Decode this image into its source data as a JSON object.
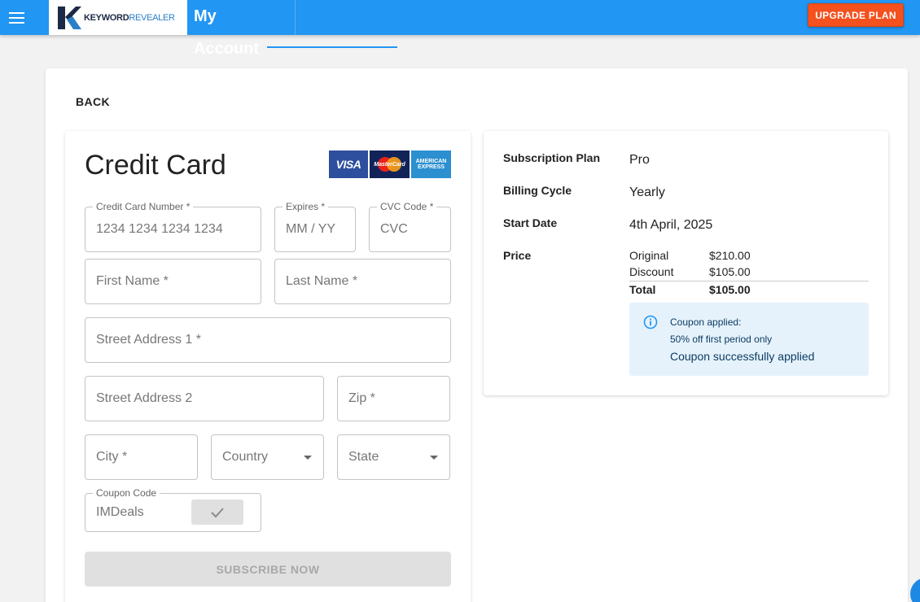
{
  "header": {
    "logo_text_bold": "KEYWORD",
    "logo_text_light": "REVEALER",
    "title": "My Account",
    "upgrade_label": "UPGRADE PLAN",
    "icons": [
      "menu-icon"
    ],
    "colors": {
      "primary": "#2196f3",
      "upgrade": "#f4511e"
    }
  },
  "back_label": "BACK",
  "form": {
    "title": "Credit Card",
    "card_logos": {
      "visa": "VISA",
      "mastercard": "MasterCard",
      "amex_line1": "AMERICAN",
      "amex_line2": "EXPRESS"
    },
    "card_number": {
      "label": "Credit Card Number *",
      "placeholder": "1234 1234 1234 1234"
    },
    "expires": {
      "label": "Expires *",
      "placeholder": "MM / YY"
    },
    "cvc": {
      "label": "CVC Code *",
      "placeholder": "CVC"
    },
    "first_name": {
      "placeholder": "First Name *"
    },
    "last_name": {
      "placeholder": "Last Name *"
    },
    "street1": {
      "placeholder": "Street Address 1 *"
    },
    "street2": {
      "placeholder": "Street Address 2"
    },
    "zip": {
      "placeholder": "Zip *"
    },
    "city": {
      "placeholder": "City *"
    },
    "country": {
      "placeholder": "Country"
    },
    "state": {
      "placeholder": "State"
    },
    "coupon": {
      "label": "Coupon Code",
      "value": "IMDeals"
    },
    "subscribe_label": "SUBSCRIBE NOW"
  },
  "summary": {
    "plan_label": "Subscription Plan",
    "plan_value": "Pro",
    "cycle_label": "Billing Cycle",
    "cycle_value": "Yearly",
    "start_label": "Start Date",
    "start_value": "4th April, 2025",
    "price_label": "Price",
    "original_label": "Original",
    "original_value": "$210.00",
    "discount_label": "Discount",
    "discount_value": "$105.00",
    "total_label": "Total",
    "total_value": "$105.00",
    "coupon_line1": "Coupon applied:",
    "coupon_line2": "50% off first period only",
    "coupon_line3": "Coupon successfully applied"
  }
}
